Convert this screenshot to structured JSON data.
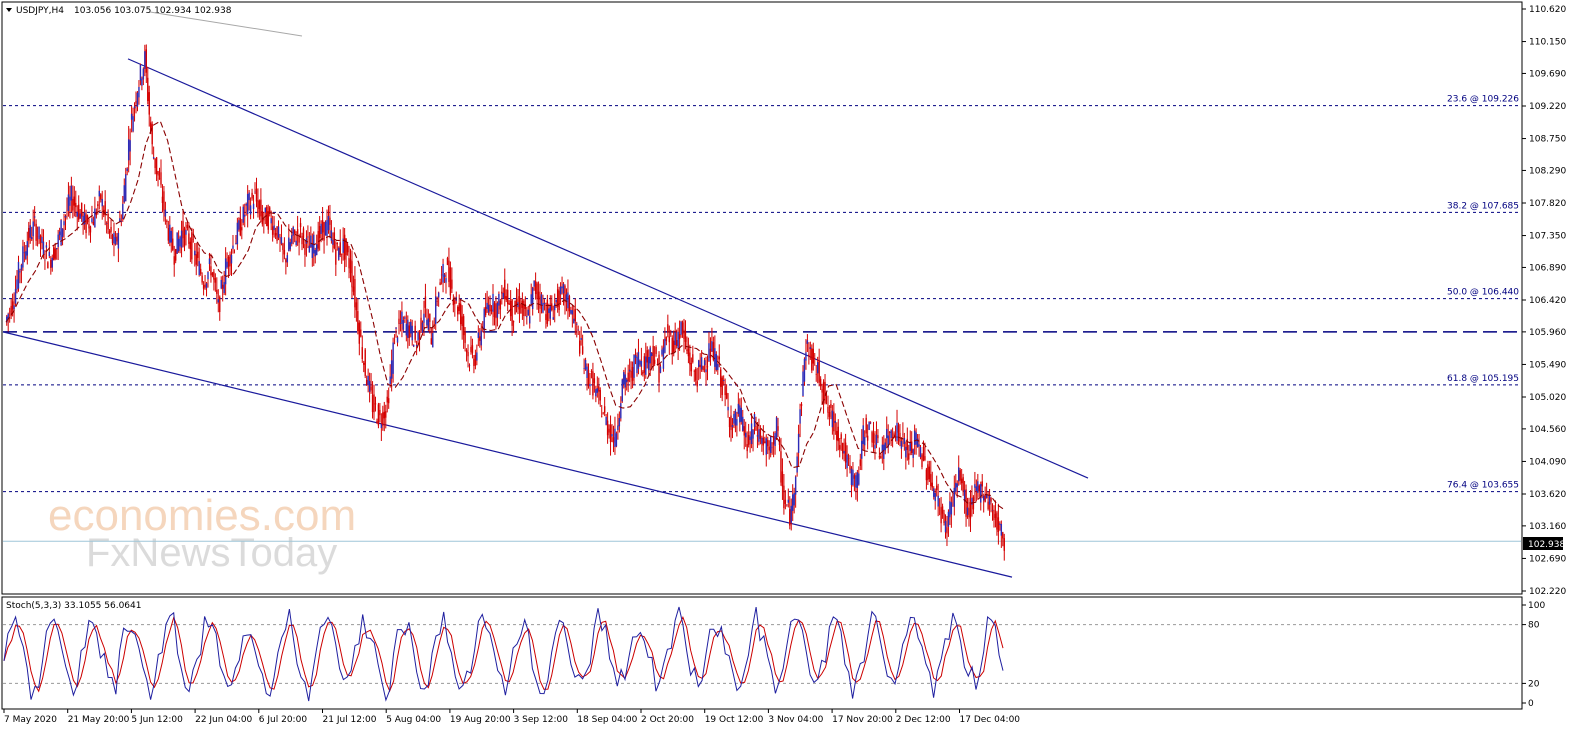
{
  "header": {
    "symbol": "USDJPY,H4",
    "ohlc": "103.056 103.075 102.934 102.938",
    "triangle_icon": "triangle-down-icon"
  },
  "indicator": {
    "label": "Stoch(5,3,3) 33.1055 56.0641",
    "scale_labels": [
      "100",
      "80",
      "20",
      "0"
    ]
  },
  "watermark": {
    "line1": "economies.com",
    "line2": "FxNewsToday"
  },
  "colors": {
    "background": "#ffffff",
    "candles": "#d40000",
    "candle_up": "#2b2bb8",
    "moving_average": "#8b0000",
    "trendline": "#1a1a9c",
    "fib_lines": "#000080",
    "price_line": "#9fc6d8",
    "stoch_main": "#1f1fa0",
    "stoch_signal": "#cc0000"
  },
  "chart_data": {
    "type": "line",
    "title": "USDJPY,H4",
    "price_axis": {
      "ticks": [
        "110.620",
        "110.150",
        "109.690",
        "109.220",
        "108.750",
        "108.290",
        "107.820",
        "107.350",
        "106.890",
        "106.420",
        "105.960",
        "105.490",
        "105.020",
        "104.560",
        "104.090",
        "103.620",
        "103.160",
        "102.690",
        "102.220"
      ],
      "range": [
        102.22,
        110.62
      ]
    },
    "current_price": "102.938",
    "x_ticks": [
      "7 May 2020",
      "21 May 20:00",
      "5 Jun 12:00",
      "22 Jun 04:00",
      "6 Jul 20:00",
      "21 Jul 12:00",
      "5 Aug 04:00",
      "19 Aug 20:00",
      "3 Sep 12:00",
      "18 Sep 04:00",
      "2 Oct 20:00",
      "19 Oct 12:00",
      "3 Nov 04:00",
      "17 Nov 20:00",
      "2 Dec 12:00",
      "17 Dec 04:00"
    ],
    "fibonacci": [
      {
        "label": "23.6 @ 109.226",
        "value": 109.226
      },
      {
        "label": "38.2 @ 107.685",
        "value": 107.685
      },
      {
        "label": "50.0 @ 106.440",
        "value": 106.44
      },
      {
        "label": "61.8 @ 105.195",
        "value": 105.195
      },
      {
        "label": "76.4 @ 103.655",
        "value": 103.655
      }
    ],
    "key_level": 105.96,
    "series": [
      {
        "values": [
          106.1,
          106.4,
          106.9,
          107.3,
          107.5,
          107.2,
          107.0,
          107.2,
          107.6,
          107.9,
          107.7,
          107.5,
          107.6,
          107.9,
          107.4,
          107.2,
          107.8,
          108.9,
          109.5,
          109.9,
          108.6,
          108.1,
          107.5,
          107.1,
          107.4,
          107.3,
          107.0,
          106.7,
          106.9,
          106.3,
          106.9,
          107.2,
          107.5,
          107.8,
          107.9,
          107.6,
          107.6,
          107.4,
          107.0,
          107.3,
          107.4,
          107.2,
          107.2,
          107.4,
          107.5,
          107.1,
          107.2,
          106.9,
          106.1,
          105.4,
          104.9,
          104.7,
          104.9,
          105.9,
          106.1,
          106.0,
          105.8,
          106.3,
          105.9,
          106.6,
          106.9,
          106.5,
          106.2,
          105.6,
          105.6,
          106.1,
          106.4,
          106.3,
          106.6,
          106.2,
          106.4,
          106.1,
          106.6,
          106.4,
          106.2,
          106.4,
          106.5,
          106.3,
          105.9,
          105.4,
          105.2,
          104.9,
          104.6,
          104.4,
          105.2,
          105.3,
          105.6,
          105.5,
          105.7,
          105.4,
          105.9,
          105.8,
          106.0,
          105.6,
          105.3,
          105.5,
          105.7,
          105.5,
          105.0,
          104.6,
          104.8,
          104.3,
          104.6,
          104.4,
          104.2,
          104.6,
          103.5,
          103.3,
          104.5,
          105.8,
          105.5,
          105.3,
          104.8,
          104.6,
          104.3,
          103.9,
          103.8,
          104.6,
          104.5,
          104.2,
          104.4,
          104.6,
          104.4,
          104.2,
          104.4,
          104.1,
          103.8,
          103.5,
          103.1,
          103.6,
          103.9,
          103.3,
          103.6,
          103.7,
          103.5,
          103.2,
          102.94
        ]
      }
    ],
    "stochastic": {
      "label": "Stoch(5,3,3)",
      "main": 33.1055,
      "signal": 56.0641,
      "levels": [
        80,
        20
      ]
    }
  }
}
